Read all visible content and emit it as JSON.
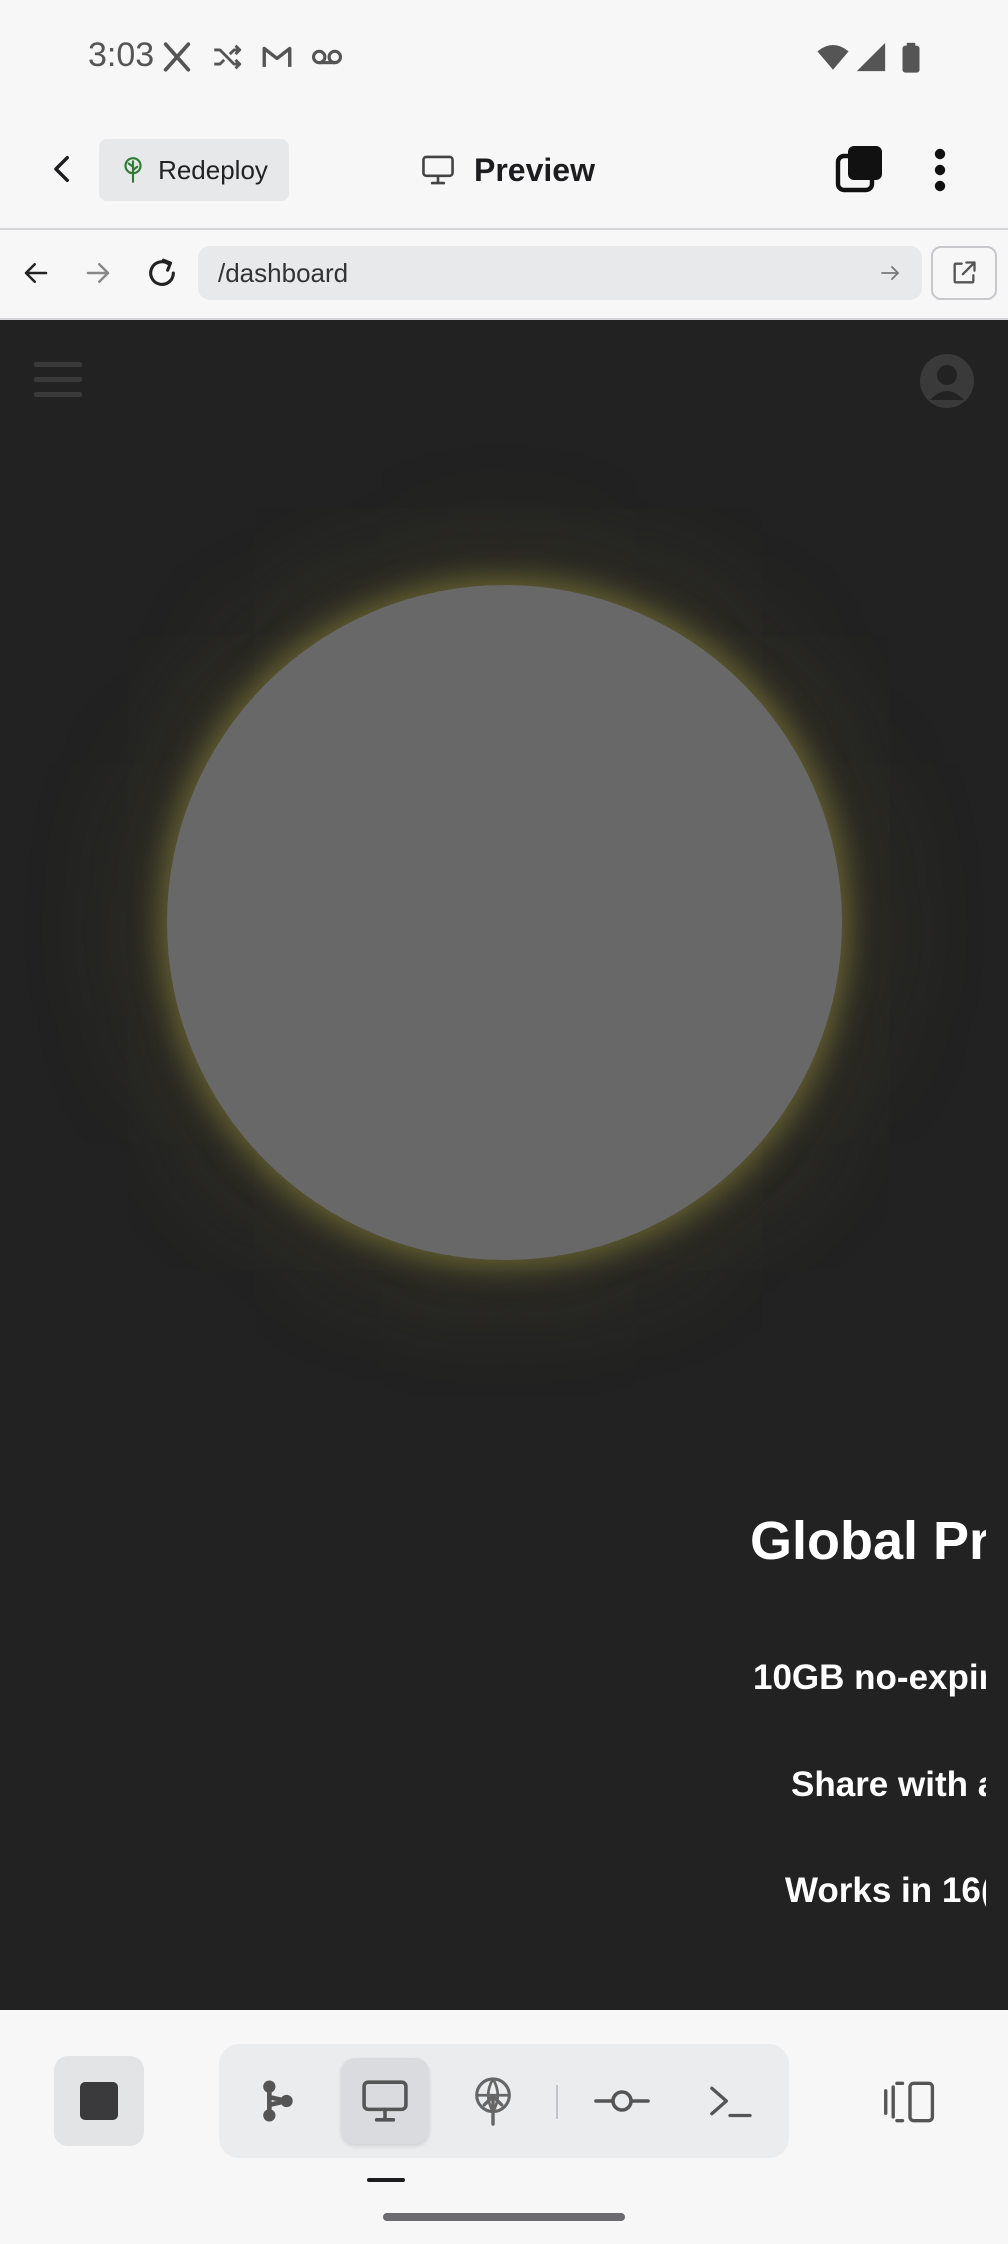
{
  "status_bar": {
    "time": "3:03",
    "notification_icons": [
      "x-icon",
      "shuffle-icon",
      "gmail-icon",
      "voicemail-icon"
    ],
    "system_icons": [
      "wifi-icon",
      "signal-icon",
      "battery-icon"
    ]
  },
  "app_bar": {
    "back_icon": "chevron-left-icon",
    "redeploy_label": "Redeploy",
    "title": "Preview",
    "title_icon": "monitor-icon",
    "layers_icon": "layers-icon",
    "menu_icon": "more-vertical-icon"
  },
  "browser": {
    "url": "/dashboard",
    "buttons": [
      "arrow-left-icon",
      "arrow-right-icon",
      "refresh-icon",
      "external-link-icon"
    ]
  },
  "webpage": {
    "heading": "Global Pri",
    "features": [
      "10GB no-expir",
      "Share with a",
      "Works in 16("
    ]
  },
  "bottom_toolbar": {
    "tools": [
      "workflow-icon",
      "monitor-icon",
      "deploy-icon",
      "commit-icon",
      "terminal-icon"
    ],
    "active_tool": "monitor-icon"
  },
  "colors": {
    "web_background": "#222222",
    "globe_fill": "#686868",
    "globe_glow": "#918c3c",
    "redeploy_icon": "#2e7d32"
  }
}
